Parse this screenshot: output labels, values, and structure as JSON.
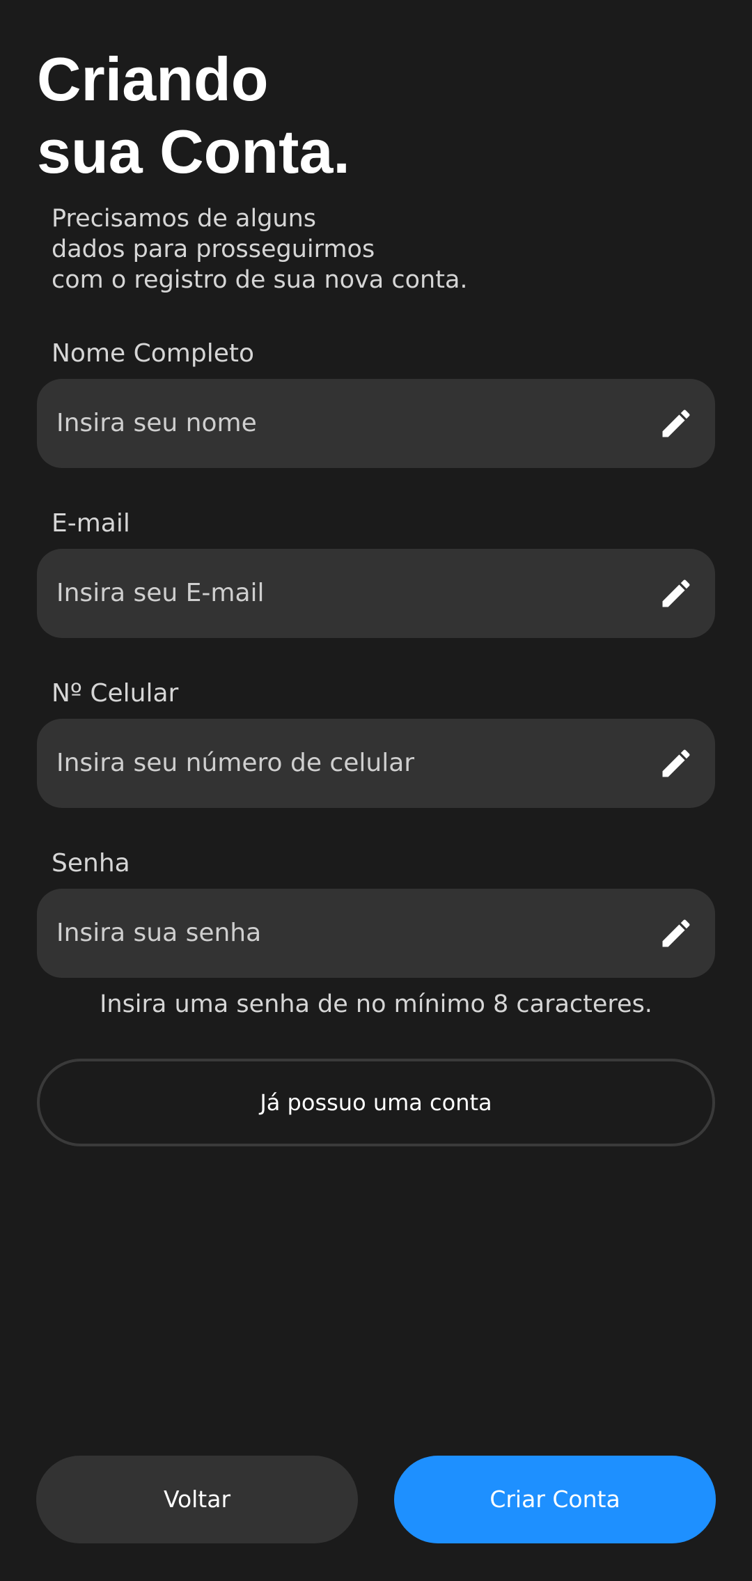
{
  "header": {
    "title_line1": "Criando",
    "title_line2": "sua Conta.",
    "subtitle_line1": "Precisamos de alguns",
    "subtitle_line2": "dados para prosseguirmos",
    "subtitle_line3": "com o registro de sua nova conta."
  },
  "form": {
    "fields": [
      {
        "label": "Nome Completo",
        "placeholder": "Insira seu nome",
        "icon": "pencil-icon"
      },
      {
        "label": "E-mail",
        "placeholder": "Insira seu E-mail",
        "icon": "pencil-icon"
      },
      {
        "label": "Nº Celular",
        "placeholder": "Insira seu número de celular",
        "icon": "pencil-icon"
      },
      {
        "label": "Senha",
        "placeholder": "Insira sua senha",
        "icon": "pencil-icon"
      }
    ],
    "password_hint": "Insira uma senha de no mínimo 8 caracteres."
  },
  "actions": {
    "have_account_label": "Já possuo uma conta",
    "back_label": "Voltar",
    "create_label": "Criar Conta"
  },
  "colors": {
    "background": "#1b1b1b",
    "field_background": "#333333",
    "primary": "#1e90ff",
    "text": "#ffffff",
    "muted_text": "#d6d6d6"
  }
}
